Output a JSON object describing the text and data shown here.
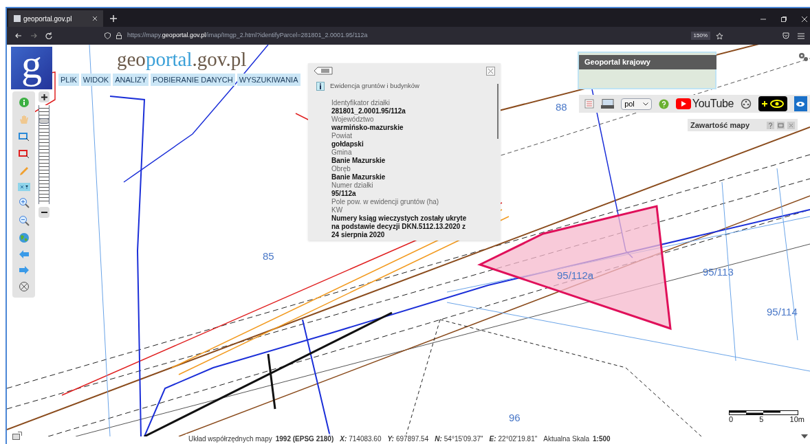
{
  "browser": {
    "tab": {
      "title": "geoportal.gov.pl",
      "selected": true
    },
    "url": "https://mapy.**geoportal.gov.pl**/imap/Imgp_2.html?identifyParcel=281801_2.0001.95/112a",
    "zoom": "150%"
  },
  "header": {
    "logo_letter": "g",
    "title_part1": "geo",
    "title_part2": "portal",
    "title_part3": ".gov.pl",
    "menu": [
      "PLIK",
      "WIDOK",
      "ANALIZY",
      "POBIERANIE DANYCH",
      "WYSZUKIWANIA"
    ]
  },
  "tools": {
    "zoom_slider": {
      "level": 0.84
    }
  },
  "info_panel": {
    "title": "Ewidencja gruntów i budynków",
    "fields": [
      {
        "label": "Identyfikator działki",
        "value": "281801_2.0001.95/112a"
      },
      {
        "label": "Województwo",
        "value": "warmińsko-mazurskie"
      },
      {
        "label": "Powiat",
        "value": "gołdapski"
      },
      {
        "label": "Gmina",
        "value": "Banie Mazurskie"
      },
      {
        "label": "Obręb",
        "value": "Banie Mazurskie"
      },
      {
        "label": "Numer działki",
        "value": "95/112a"
      },
      {
        "label": "Pole pow. w ewidencji gruntów (ha)"
      },
      {
        "label": "KW",
        "value": "Numery ksiąg wieczystych zostały ukryte na podstawie decyzji DKN.5112.13.2020 z 24 sierpnia 2020"
      }
    ]
  },
  "overview": {
    "title": "Geoportal krajowy"
  },
  "right_toolbar": {
    "language": "pol",
    "youtube": "YouTube"
  },
  "map_contents": {
    "title": "Zawartość mapy"
  },
  "map": {
    "parcel_labels": [
      "88",
      "85",
      "95/112a",
      "95/113",
      "95/114",
      "96"
    ]
  },
  "scale_bar": {
    "ticks": [
      "0",
      "5",
      "10m"
    ]
  },
  "status_bar": {
    "crs_label": "Układ współrzędnych mapy",
    "crs": "1992 (EPSG 2180)",
    "coords": [
      {
        "label": "X:",
        "value": "714083.60"
      },
      {
        "label": "Y:",
        "value": "697897.54"
      },
      {
        "label": "N:",
        "value": "54°15'09.37\""
      },
      {
        "label": "E:",
        "value": "22°02'19.81\""
      }
    ],
    "scale_label": "Aktualna Skala",
    "scale": "1:500"
  }
}
